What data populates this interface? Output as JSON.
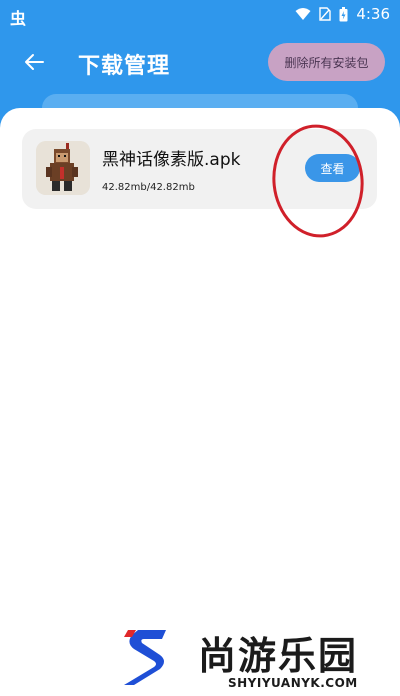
{
  "status_bar": {
    "left_glyph": "虫",
    "time": "4:36"
  },
  "app_bar": {
    "title": "下载管理",
    "delete_all_label": "删除所有安装包"
  },
  "downloads": [
    {
      "file_name": "黑神话像素版.apk",
      "size_text": "42.82mb/42.82mb",
      "action_label": "查看"
    }
  ],
  "watermark": {
    "cn": "尚游乐园",
    "en": "SHYIYUANYK.COM"
  },
  "colors": {
    "header_blue": "#2f97ec",
    "button_blue": "#3a96e8",
    "delete_button_bg": "#c8a2c4",
    "annotation_red": "#d0202a"
  },
  "icons": [
    "back-arrow-icon",
    "wifi-icon",
    "sim-card-icon",
    "battery-icon",
    "app-icon"
  ]
}
